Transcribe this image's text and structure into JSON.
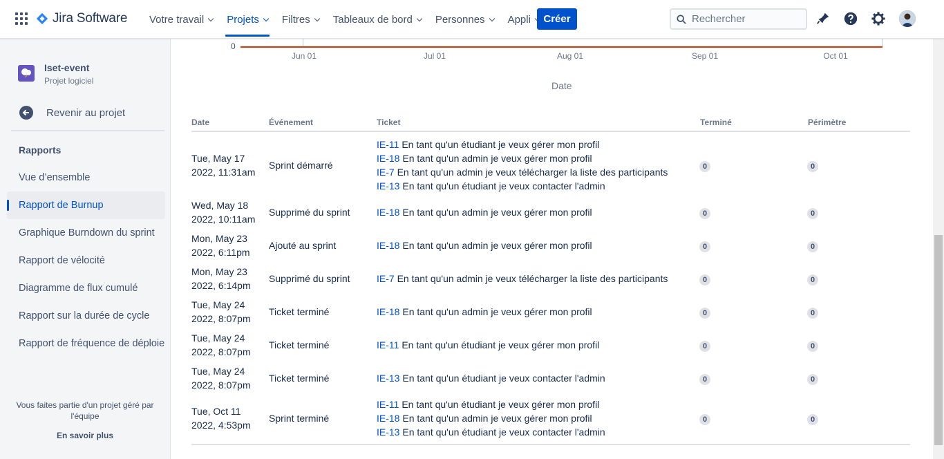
{
  "brand": {
    "name": "Jira Software",
    "color": "#2684ff"
  },
  "nav": [
    {
      "label": "Votre travail",
      "active": false
    },
    {
      "label": "Projets",
      "active": true
    },
    {
      "label": "Filtres",
      "active": false
    },
    {
      "label": "Tableaux de bord",
      "active": false
    },
    {
      "label": "Personnes",
      "active": false
    },
    {
      "label": "Appli",
      "active": false
    }
  ],
  "create_label": "Créer",
  "search": {
    "placeholder": "Rechercher"
  },
  "topbar_icons": [
    "notifications-icon",
    "help-icon",
    "settings-icon",
    "avatar"
  ],
  "project": {
    "name": "Iset-event",
    "type": "Projet logiciel"
  },
  "back_label": "Revenir au projet",
  "section_title": "Rapports",
  "menu": [
    {
      "label": "Vue d’ensemble",
      "active": false
    },
    {
      "label": "Rapport de Burnup",
      "active": true
    },
    {
      "label": "Graphique Burndown du sprint",
      "active": false
    },
    {
      "label": "Rapport de vélocité",
      "active": false
    },
    {
      "label": "Diagramme de flux cumulé",
      "active": false
    },
    {
      "label": "Rapport sur la durée de cycle",
      "active": false
    },
    {
      "label": "Rapport de fréquence de déploiement",
      "active": false
    }
  ],
  "footer": {
    "text": "Vous faites partie d'un projet géré par l'équipe",
    "link": "En savoir plus"
  },
  "chart": {
    "y_tick": "0",
    "x_ticks": [
      "Jun 01",
      "Jul 01",
      "Aug 01",
      "Sep 01",
      "Oct 01"
    ],
    "x_title": "Date",
    "line_color": "#de350b"
  },
  "table": {
    "headers": {
      "date": "Date",
      "event": "Événement",
      "ticket": "Ticket",
      "done": "Terminé",
      "scope": "Périmètre"
    },
    "rows": [
      {
        "date": [
          "Tue, May 17",
          "2022, 11:31am"
        ],
        "event": "Sprint démarré",
        "tickets": [
          {
            "key": "IE-11",
            "summary": "En tant qu'un étudiant je veux gérer mon profil"
          },
          {
            "key": "IE-18",
            "summary": "En tant qu'un admin je veux gérer mon profil"
          },
          {
            "key": "IE-7",
            "summary": "En tant qu'un admin je veux télécharger la liste des participants"
          },
          {
            "key": "IE-13",
            "summary": "En tant qu'un étudiant je veux contacter l'admin"
          }
        ],
        "done": "0",
        "scope": "0"
      },
      {
        "date": [
          "Wed, May 18",
          "2022, 10:11am"
        ],
        "event": "Supprimé du sprint",
        "tickets": [
          {
            "key": "IE-18",
            "summary": "En tant qu'un admin je veux gérer mon profil"
          }
        ],
        "done": "0",
        "scope": "0"
      },
      {
        "date": [
          "Mon, May 23",
          "2022, 6:11pm"
        ],
        "event": "Ajouté au sprint",
        "tickets": [
          {
            "key": "IE-18",
            "summary": "En tant qu'un admin je veux gérer mon profil"
          }
        ],
        "done": "0",
        "scope": "0"
      },
      {
        "date": [
          "Mon, May 23",
          "2022, 6:14pm"
        ],
        "event": "Supprimé du sprint",
        "tickets": [
          {
            "key": "IE-7",
            "summary": "En tant qu'un admin je veux télécharger la liste des participants"
          }
        ],
        "done": "0",
        "scope": "0"
      },
      {
        "date": [
          "Tue, May 24",
          "2022, 8:07pm"
        ],
        "event": "Ticket terminé",
        "tickets": [
          {
            "key": "IE-18",
            "summary": "En tant qu'un admin je veux gérer mon profil"
          }
        ],
        "done": "0",
        "scope": "0"
      },
      {
        "date": [
          "Tue, May 24",
          "2022, 8:07pm"
        ],
        "event": "Ticket terminé",
        "tickets": [
          {
            "key": "IE-11",
            "summary": "En tant qu'un étudiant je veux gérer mon profil"
          }
        ],
        "done": "0",
        "scope": "0"
      },
      {
        "date": [
          "Tue, May 24",
          "2022, 8:07pm"
        ],
        "event": "Ticket terminé",
        "tickets": [
          {
            "key": "IE-13",
            "summary": "En tant qu'un étudiant je veux contacter l'admin"
          }
        ],
        "done": "0",
        "scope": "0"
      },
      {
        "date": [
          "Tue, Oct 11",
          "2022, 4:53pm"
        ],
        "event": "Sprint terminé",
        "tickets": [
          {
            "key": "IE-11",
            "summary": "En tant qu'un étudiant je veux gérer mon profil"
          },
          {
            "key": "IE-18",
            "summary": "En tant qu'un admin je veux gérer mon profil"
          },
          {
            "key": "IE-13",
            "summary": "En tant qu'un étudiant je veux contacter l'admin"
          }
        ],
        "done": "0",
        "scope": "0"
      }
    ]
  }
}
